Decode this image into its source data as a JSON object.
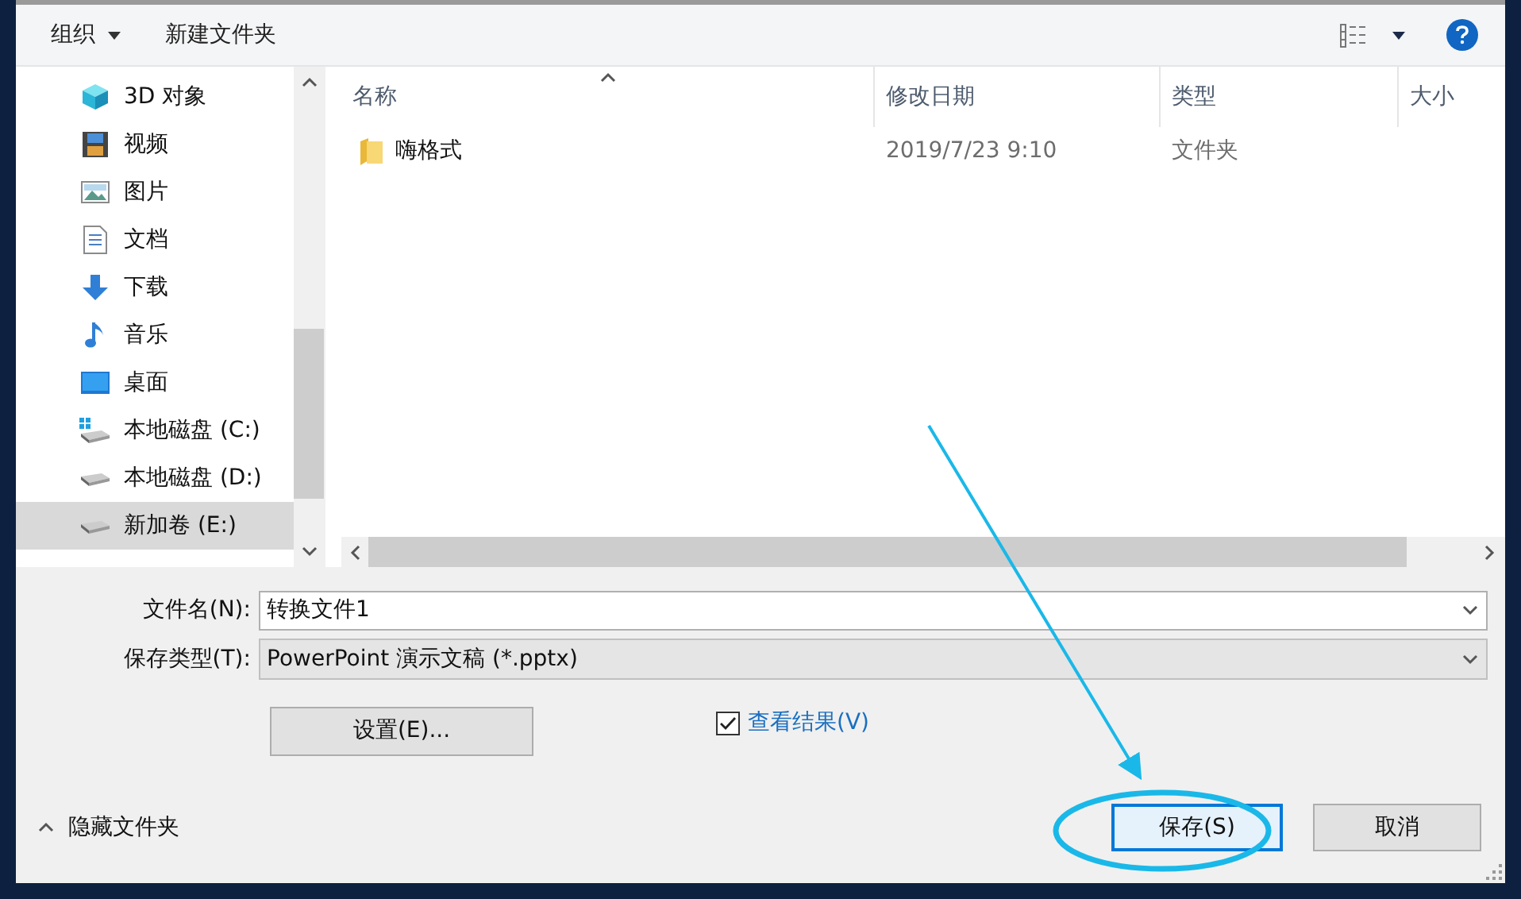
{
  "toolbar": {
    "organize": "组织",
    "new_folder": "新建文件夹"
  },
  "nav": {
    "items": [
      {
        "label": "3D 对象",
        "kind": "objects",
        "selected": false
      },
      {
        "label": "视频",
        "kind": "video",
        "selected": false
      },
      {
        "label": "图片",
        "kind": "pictures",
        "selected": false
      },
      {
        "label": "文档",
        "kind": "documents",
        "selected": false
      },
      {
        "label": "下载",
        "kind": "downloads",
        "selected": false
      },
      {
        "label": "音乐",
        "kind": "music",
        "selected": false
      },
      {
        "label": "桌面",
        "kind": "desktop",
        "selected": false
      },
      {
        "label": "本地磁盘 (C:)",
        "kind": "system",
        "selected": false
      },
      {
        "label": "本地磁盘 (D:)",
        "kind": "drive",
        "selected": false
      },
      {
        "label": "新加卷 (E:)",
        "kind": "drive",
        "selected": true
      }
    ]
  },
  "table": {
    "columns": [
      {
        "label": "名称",
        "sorted": true
      },
      {
        "label": "修改日期",
        "sorted": false
      },
      {
        "label": "类型",
        "sorted": false
      },
      {
        "label": "大小",
        "sorted": false
      }
    ],
    "rows": [
      {
        "name": "嗨格式",
        "modified": "2019/7/23 9:10",
        "type": "文件夹"
      }
    ]
  },
  "form": {
    "filename_label": "文件名(N):",
    "filename": "转换文件1",
    "filetype_label": "保存类型(T):",
    "filetype": "PowerPoint 演示文稿 (*.pptx)",
    "settings_button": "设置(E)...",
    "view_result": {
      "label": "查看结果(V)",
      "checked": true
    }
  },
  "footer": {
    "hide_folders": "隐藏文件夹",
    "save": "保存(S)",
    "cancel": "取消"
  }
}
